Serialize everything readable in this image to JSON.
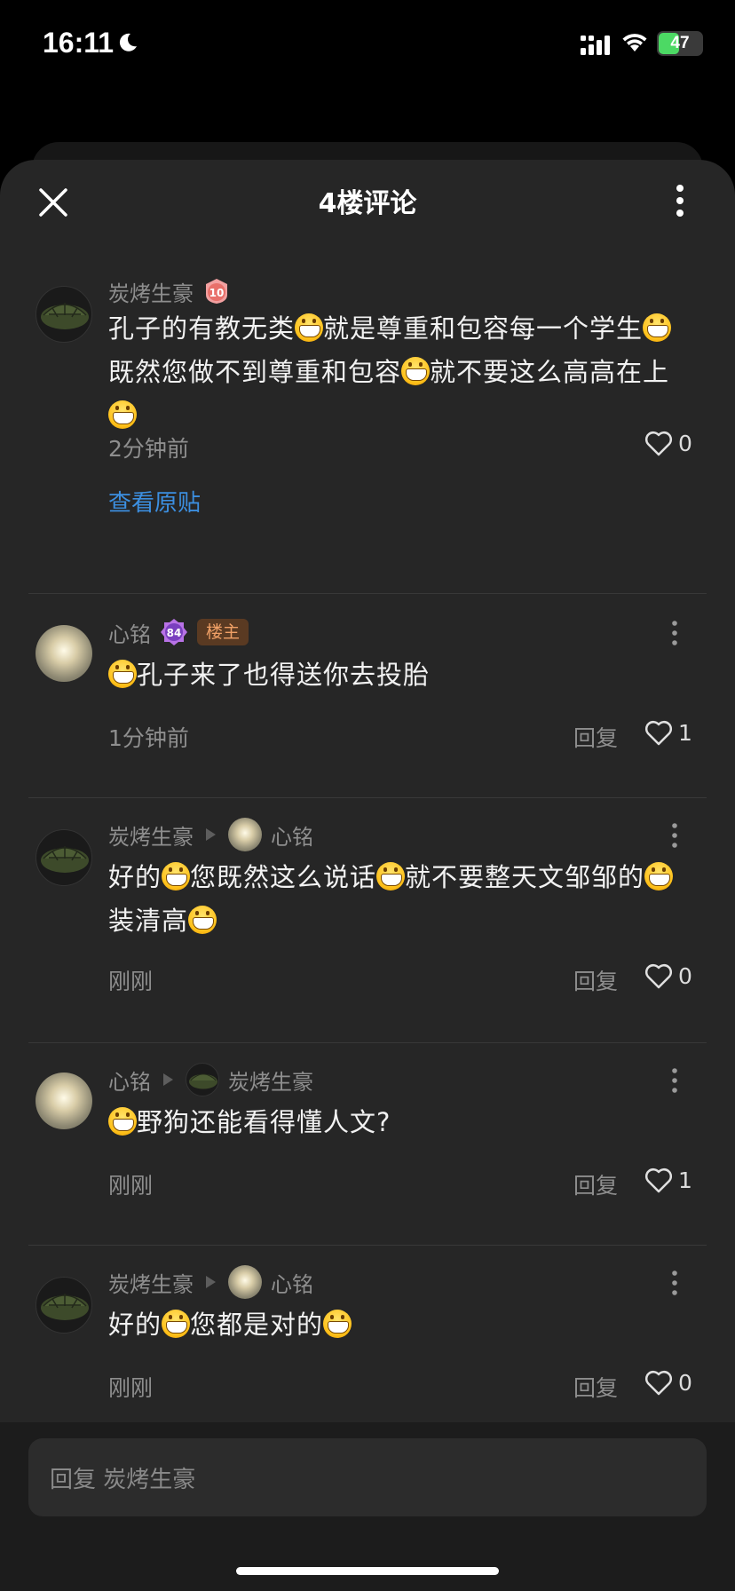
{
  "status": {
    "time": "16:11",
    "battery": "47",
    "battery_level": 0.47
  },
  "header": {
    "title": "4楼评论"
  },
  "comments": [
    {
      "author": "炭烤生豪",
      "level": "10",
      "text_parts": [
        "孔子的有教无类",
        "就是尊重和包容每一个学生",
        "既然您做不到尊重和包容",
        "就不要这么高高在上",
        ""
      ],
      "time": "2分钟前",
      "likes": "0",
      "view_original": "查看原贴"
    },
    {
      "author": "心铭",
      "level": "84",
      "owner_badge": "楼主",
      "text_parts": [
        "",
        "孔子来了也得送你去投胎"
      ],
      "time": "1分钟前",
      "reply": "回复",
      "likes": "1"
    },
    {
      "author": "炭烤生豪",
      "reply_to": "心铭",
      "text_parts": [
        "好的",
        "您既然这么说话",
        "就不要整天文邹邹的",
        "装清高",
        ""
      ],
      "time": "刚刚",
      "reply": "回复",
      "likes": "0"
    },
    {
      "author": "心铭",
      "reply_to": "炭烤生豪",
      "text_parts": [
        "",
        "野狗还能看得懂人文?"
      ],
      "time": "刚刚",
      "reply": "回复",
      "likes": "1"
    },
    {
      "author": "炭烤生豪",
      "reply_to": "心铭",
      "text_parts": [
        "好的",
        "您都是对的",
        ""
      ],
      "time": "刚刚",
      "reply": "回复",
      "likes": "0"
    }
  ],
  "input": {
    "placeholder": "回复 炭烤生豪"
  }
}
